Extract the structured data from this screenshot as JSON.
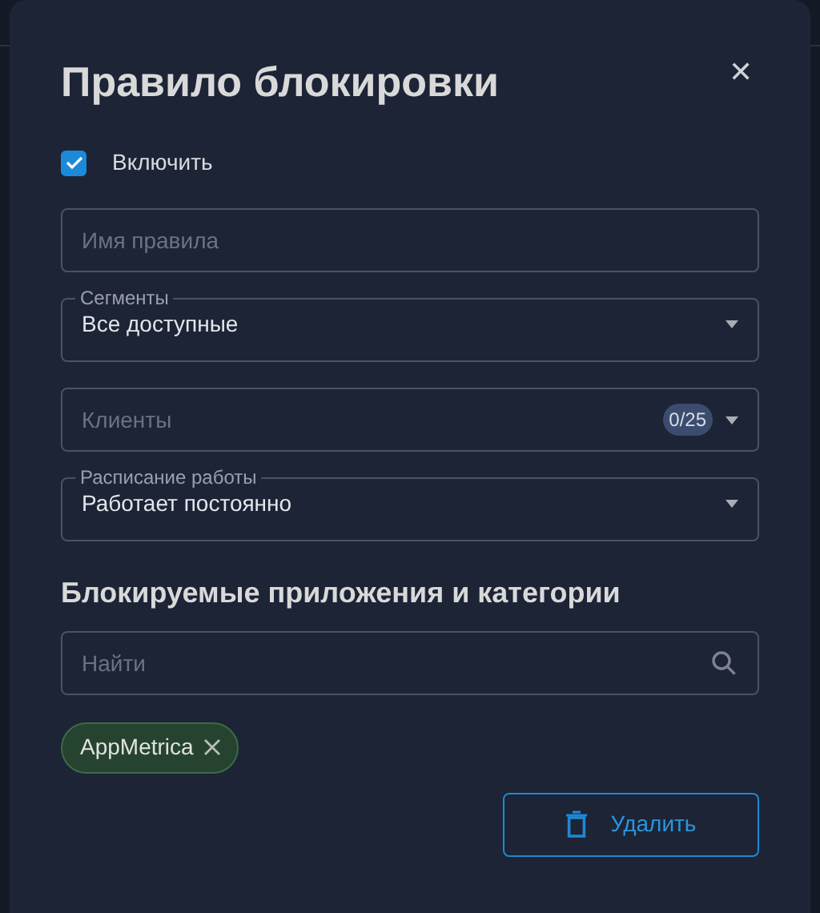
{
  "dialog": {
    "title": "Правило блокировки",
    "close": "✕"
  },
  "enable": {
    "label": "Включить",
    "checked": true
  },
  "fields": [
    {
      "kind": "text",
      "placeholder": "Имя правила"
    },
    {
      "kind": "select",
      "label": "Сегменты",
      "value": "Все доступные"
    },
    {
      "kind": "count",
      "placeholder": "Клиенты",
      "count": "0/25"
    },
    {
      "kind": "select",
      "label": "Расписание работы",
      "value": "Работает постоянно"
    }
  ],
  "apps": {
    "heading": "Блокируемые приложения и категории",
    "search_placeholder": "Найти",
    "tags": [
      {
        "label": "AppMetrica"
      }
    ]
  },
  "delete_button": "Удалить"
}
